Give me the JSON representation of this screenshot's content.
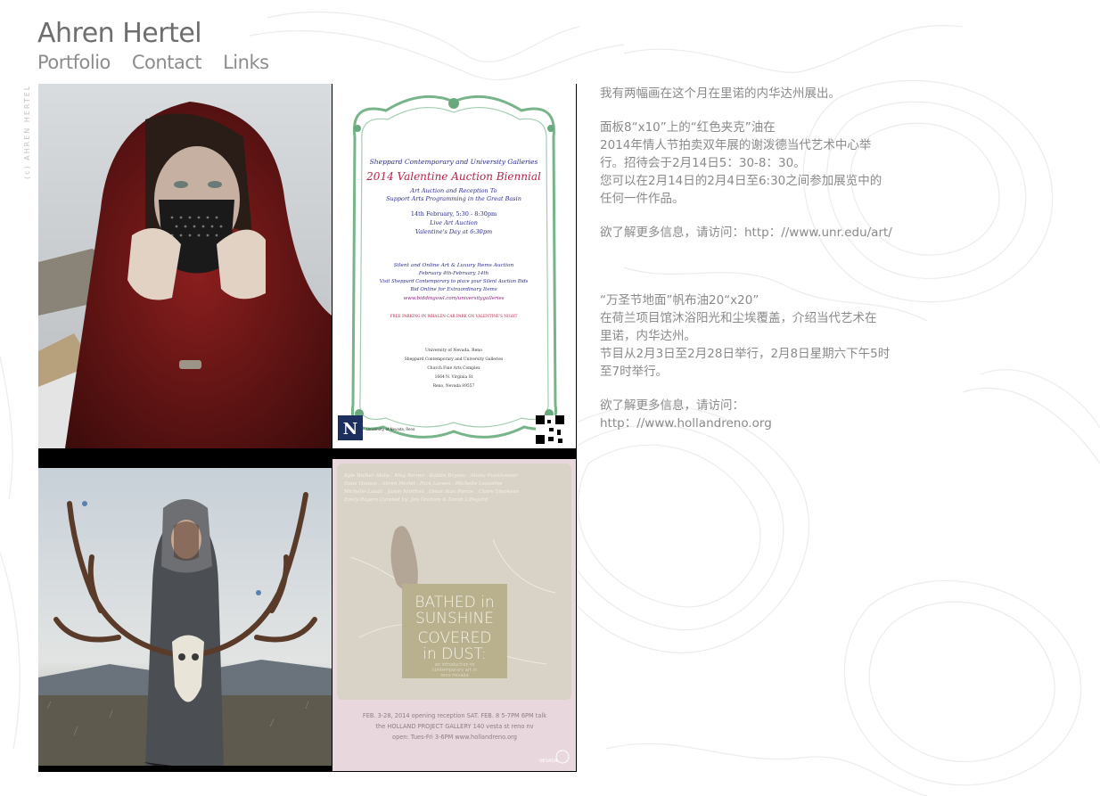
{
  "site": {
    "title": "Ahren Hertel",
    "side_credit": "(c) AHREN HERTEL"
  },
  "nav": [
    {
      "label": "Portfolio"
    },
    {
      "label": "Contact"
    },
    {
      "label": "Links"
    }
  ],
  "paintings": [
    {
      "name": "Red Coat painting"
    },
    {
      "name": "Antlers painting"
    }
  ],
  "poster_valentine": {
    "line1": "Sheppard Contemporary and University Galleries",
    "title": "2014 Valentine Auction Biennial",
    "subtitle1": "Art Auction and Reception To",
    "subtitle2": "Support Arts Programming in the Great Basin",
    "date": "14th February, 5:30 - 8:30pm",
    "live": "Live Art Auction",
    "vday": "Valentine's Day at 6:30pm",
    "silent": "Silent and Online Art & Luxury Items Auction",
    "silent_dates": "February 4th-February 14th",
    "visit": "Visit Sheppard Contemporary to place your Silent Auction Bids",
    "bid": "Bid Online for Extraordinary Items",
    "url": "www.biddingowl.com/universitygalleries",
    "parking": "FREE PARKING IN WHALEN CAR PARK ON VALENTINE'S NIGHT",
    "univ": "University of Nevada, Reno",
    "gallery": "Sheppard Contemporary and University Galleries",
    "complex": "Church Fine Arts Complex",
    "street": "1664 N. Virginia St",
    "city": "Reno, Nevada 89557",
    "logo_letter": "N",
    "logo_text": "University of Nevada, Reno"
  },
  "poster_holland": {
    "names1": "Kyle Walker Akins . Meg Berner . Kaitlin Bryson . Alisha Funkhouser",
    "names2": "Dane Haman . Ahren Hertel . Nick Larsen . Michelle Lassaline",
    "names3": "Michelle Lasalt . Jason Northon . Omar Alan Pierce . Claire Stephens",
    "names4": "Emily Rogers        Curated by: Jen Graham & Sarah Lillegard",
    "title1": "BATHED in",
    "title2": "SUNSHINE",
    "title3": "COVERED",
    "title4": "in DUST:",
    "sub1": "an introduction to",
    "sub2": "contemporary art in",
    "sub3": "reno nevada",
    "footer1": "FEB. 3-28, 2014 opening reception SAT. FEB. 8 5-7PM 6PM talk",
    "footer2": "the HOLLAND PROJECT GALLERY  140 vesta st reno nv",
    "footer3": "open: Tues-Fri 3-6PM   www.hollandreno.org",
    "mark": "NEVADA"
  },
  "content": {
    "p1": "我有两幅画在这个月在里诺的内华达州展出。",
    "p2a": "面板8“x10”上的“红色夹克”油在",
    "p2b": "2014年情人节拍卖双年展的谢泼德当代艺术中心举",
    "p2c": "行。招待会于2月14日5：30-8：30。",
    "p2d": "您可以在2月14日的2月4日至6:30之间参加展览中的",
    "p2e": "任何一件作品。",
    "p3": "欲了解更多信息，请访问：http：//www.unr.edu/art/",
    "p4a": "“万圣节地面”帆布油20“x20”",
    "p4b": "在荷兰项目馆沐浴阳光和尘埃覆盖，介绍当代艺术在",
    "p4c": "里诺，内华达州。",
    "p4d": "节目从2月3日至2月28日举行，2月8日星期六下午5时",
    "p4e": "至7时举行。",
    "p5a": "欲了解更多信息，请访问：",
    "p5b": "http：//www.hollandreno.org"
  }
}
